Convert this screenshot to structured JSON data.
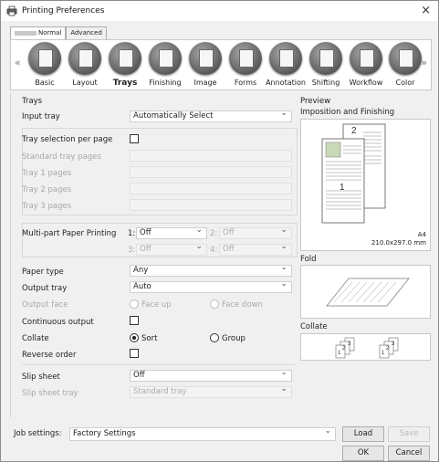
{
  "window": {
    "title": "Printing Preferences",
    "close": "×"
  },
  "tabs": [
    {
      "label": "Normal"
    },
    {
      "label": "Advanced"
    }
  ],
  "ribbon": {
    "items": [
      {
        "label": "Basic"
      },
      {
        "label": "Layout"
      },
      {
        "label": "Trays"
      },
      {
        "label": "Finishing"
      },
      {
        "label": "Image"
      },
      {
        "label": "Forms"
      },
      {
        "label": "Annotation"
      },
      {
        "label": "Shifting"
      },
      {
        "label": "Workflow"
      },
      {
        "label": "Color"
      }
    ],
    "selected": "Trays",
    "scroll_left": "«",
    "scroll_right": "»"
  },
  "trays": {
    "section": "Trays",
    "input_tray": {
      "label": "Input tray",
      "value": "Automatically Select"
    },
    "tray_selection_per_page": {
      "label": "Tray selection per page",
      "checked": false
    },
    "standard_tray_pages": {
      "label": "Standard tray pages"
    },
    "tray1_pages": {
      "label": "Tray 1 pages"
    },
    "tray2_pages": {
      "label": "Tray 2 pages"
    },
    "tray3_pages": {
      "label": "Tray 3 pages"
    },
    "multipart": {
      "label": "Multi-part Paper Printing",
      "slots": [
        {
          "num": "1:",
          "value": "Off"
        },
        {
          "num": "2:",
          "value": "Off"
        },
        {
          "num": "3:",
          "value": "Off"
        },
        {
          "num": "4:",
          "value": "Off"
        }
      ]
    },
    "paper_type": {
      "label": "Paper type",
      "value": "Any"
    },
    "output_tray": {
      "label": "Output tray",
      "value": "Auto"
    },
    "output_face": {
      "label": "Output face",
      "face_up": "Face up",
      "face_down": "Face down"
    },
    "continuous_output": {
      "label": "Continuous output",
      "checked": false
    },
    "collate": {
      "label": "Collate",
      "sort": "Sort",
      "group": "Group",
      "selected": "Sort"
    },
    "reverse_order": {
      "label": "Reverse order",
      "checked": false
    },
    "slip_sheet": {
      "label": "Slip sheet",
      "value": "Off"
    },
    "slip_sheet_tray": {
      "label": "Slip sheet tray",
      "value": "Standard tray"
    }
  },
  "preview": {
    "section": "Preview",
    "imposition_label": "Imposition and Finishing",
    "page_num_front": "1",
    "page_num_back": "2",
    "paper_size": "A4",
    "paper_dims": "210.0x297.0 mm",
    "fold_label": "Fold",
    "collate_label": "Collate",
    "collate_nums": [
      "1",
      "2",
      "3",
      "1",
      "2",
      "3"
    ]
  },
  "footer": {
    "job_settings_label": "Job settings:",
    "job_settings_value": "Factory Settings",
    "load": "Load",
    "save": "Save",
    "ok": "OK",
    "cancel": "Cancel"
  }
}
